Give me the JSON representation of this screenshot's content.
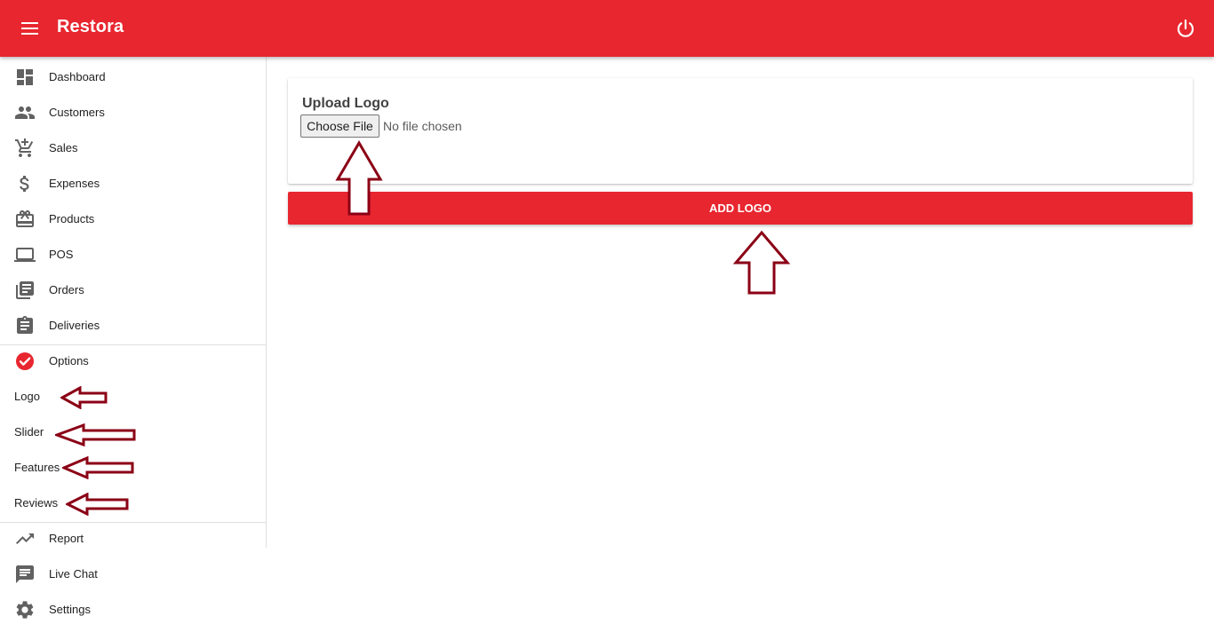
{
  "app": {
    "title": "Restora"
  },
  "header": {
    "menu_icon": "menu-icon",
    "power_icon": "power-icon"
  },
  "sidebar": {
    "items": [
      {
        "label": "Dashboard",
        "icon": "dashboard-icon"
      },
      {
        "label": "Customers",
        "icon": "people-icon"
      },
      {
        "label": "Sales",
        "icon": "add-shopping-cart-icon"
      },
      {
        "label": "Expenses",
        "icon": "dollar-icon"
      },
      {
        "label": "Products",
        "icon": "card-giftcard-icon"
      },
      {
        "label": "POS",
        "icon": "laptop-icon"
      },
      {
        "label": "Orders",
        "icon": "library-books-icon"
      },
      {
        "label": "Deliveries",
        "icon": "assignment-icon"
      }
    ],
    "options": {
      "label": "Options",
      "icon": "check-circle-icon",
      "sub_items": [
        {
          "label": "Logo"
        },
        {
          "label": "Slider"
        },
        {
          "label": "Features"
        },
        {
          "label": "Reviews"
        }
      ]
    },
    "bottom_items": [
      {
        "label": "Report",
        "icon": "trending-up-icon"
      },
      {
        "label": "Live Chat",
        "icon": "chat-icon"
      },
      {
        "label": "Settings",
        "icon": "settings-icon"
      }
    ]
  },
  "main": {
    "upload_card": {
      "title": "Upload Logo",
      "choose_file_label": "Choose File",
      "file_status": "No file chosen"
    },
    "add_logo_button": "ADD LOGO"
  },
  "colors": {
    "brand": "#e8262f",
    "annotation_arrow": "#8b0015",
    "icon": "#616161"
  }
}
